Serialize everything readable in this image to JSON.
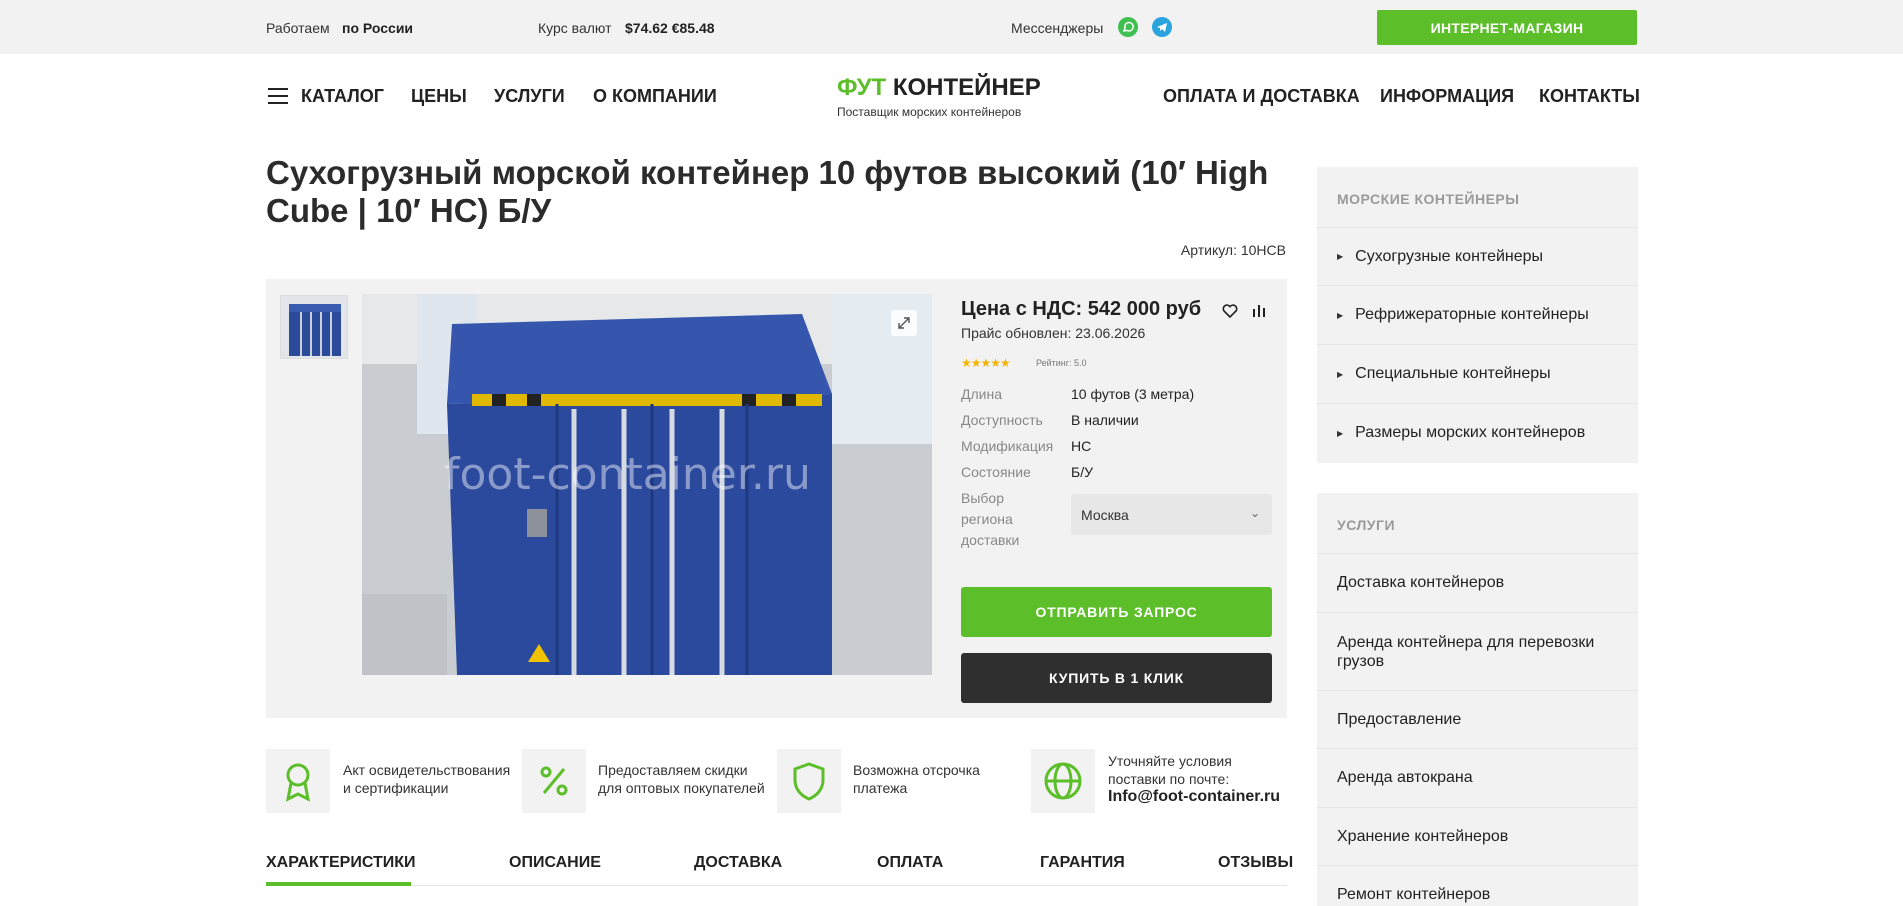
{
  "topbar": {
    "work_label": "Работаем",
    "work_value": "по России",
    "rate_label": "Курс валют",
    "rate_value": "$74.62 €85.48",
    "messengers_label": "Мессенджеры",
    "shop_button": "ИНТЕРНЕТ-МАГАЗИН"
  },
  "header": {
    "nav_left": [
      "КАТАЛОГ",
      "ЦЕНЫ",
      "УСЛУГИ",
      "О КОМПАНИИ"
    ],
    "logo_green": "ФУТ",
    "logo_dark": "КОНТЕЙНЕР",
    "logo_subtitle": "Поставщик морских контейнеров",
    "nav_right": [
      "ОПЛАТА И ДОСТАВКА",
      "ИНФОРМАЦИЯ",
      "КОНТАКТЫ"
    ]
  },
  "product": {
    "title": "Сухогрузный морской контейнер 10 футов высокий (10′ High Cube | 10′ HC) Б/У",
    "sku": "Артикул: 10HCB",
    "watermark": "foot-container.ru",
    "price": "Цена с НДС: 542 000 руб",
    "updated": "Прайс обновлен: 23.06.2026",
    "stars": "★★★★★",
    "rating": "Рейтинг: 5.0",
    "props": [
      {
        "key": "Длина",
        "value": "10 футов (3 метра)"
      },
      {
        "key": "Доступность",
        "value": "В наличии"
      },
      {
        "key": "Модификация",
        "value": "HC"
      },
      {
        "key": "Состояние",
        "value": "Б/У"
      }
    ],
    "region_label_1": "Выбор",
    "region_label_2": "региона",
    "region_label_3": "доставки",
    "region_value": "Москва",
    "btn_request": "ОТПРАВИТЬ ЗАПРОС",
    "btn_buy": "КУПИТЬ В 1 КЛИК"
  },
  "features": [
    {
      "line1": "Акт освидетельствования",
      "line2": "и сертификации"
    },
    {
      "line1": "Предоставляем скидки",
      "line2": "для оптовых покупателей"
    },
    {
      "line1": "Возможна отсрочка",
      "line2": "платежа"
    },
    {
      "line1": "Уточняйте условия",
      "line2": "поставки по почте:",
      "mail": "Info@foot-container.ru"
    }
  ],
  "tabs": [
    "ХАРАКТЕРИСТИКИ",
    "ОПИСАНИЕ",
    "ДОСТАВКА",
    "ОПЛАТА",
    "ГАРАНТИЯ",
    "ОТЗЫВЫ"
  ],
  "sidebar": {
    "containers_title": "МОРСКИЕ КОНТЕЙНЕРЫ",
    "containers": [
      "Сухогрузные контейнеры",
      "Рефрижераторные контейнеры",
      "Специальные контейнеры",
      "Размеры морских контейнеров"
    ],
    "services_title": "УСЛУГИ",
    "services": [
      "Доставка контейнеров",
      "Аренда контейнера для перевозки грузов",
      "Предоставление",
      "Аренда автокрана",
      "Хранение контейнеров",
      "Ремонт контейнеров"
    ]
  },
  "colors": {
    "accent": "#5cbf2a",
    "dark_button": "#2f2f2f",
    "panel": "#f2f2f2"
  }
}
